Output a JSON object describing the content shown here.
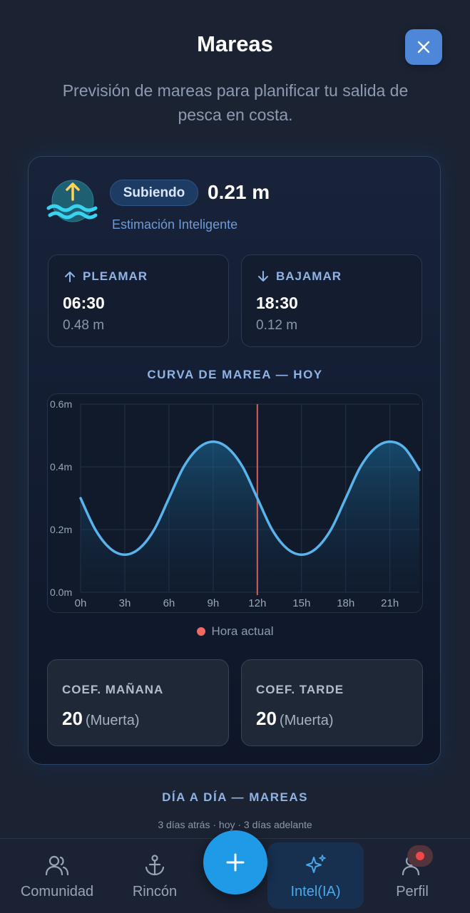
{
  "header": {
    "title": "Mareas",
    "subtitle": "Previsión de mareas para planificar tu salida de pesca en costa."
  },
  "status": {
    "trend_label": "Subiendo",
    "current_height": "0.21 m",
    "source_label": "Estimación Inteligente"
  },
  "high_tide": {
    "label": "PLEAMAR",
    "time": "06:30",
    "height": "0.48 m"
  },
  "low_tide": {
    "label": "BAJAMAR",
    "time": "18:30",
    "height": "0.12 m"
  },
  "curve": {
    "title": "CURVA DE MAREA — HOY",
    "legend_now": "Hora actual"
  },
  "chart_data": {
    "type": "area",
    "title": "CURVA DE MAREA — HOY",
    "x_ticks": [
      "0h",
      "3h",
      "6h",
      "9h",
      "12h",
      "15h",
      "18h",
      "21h"
    ],
    "y_ticks": [
      "0.0m",
      "0.2m",
      "0.4m",
      "0.6m"
    ],
    "xlim": [
      0,
      23
    ],
    "ylim": [
      0,
      0.6
    ],
    "current_hour": 12,
    "series": [
      {
        "x": [
          0,
          1,
          2,
          3,
          4,
          5,
          6,
          7,
          8,
          9,
          10,
          11,
          12,
          13,
          14,
          15,
          16,
          17,
          18,
          19,
          20,
          21,
          22,
          23
        ],
        "y": [
          0.3,
          0.2,
          0.14,
          0.12,
          0.14,
          0.2,
          0.3,
          0.4,
          0.46,
          0.48,
          0.46,
          0.4,
          0.3,
          0.2,
          0.14,
          0.12,
          0.14,
          0.2,
          0.3,
          0.4,
          0.46,
          0.48,
          0.46,
          0.39
        ]
      }
    ],
    "colors": {
      "line": "#5ab4ec",
      "now": "#f06a63",
      "grid": "#26324a"
    }
  },
  "coefficients": {
    "morning": {
      "label": "COEF. MAÑANA",
      "value": "20",
      "quality": "(Muerta)"
    },
    "afternoon": {
      "label": "COEF. TARDE",
      "value": "20",
      "quality": "(Muerta)"
    }
  },
  "daily": {
    "title": "DÍA A DÍA — MAREAS",
    "subtitle": "3 días atrás · hoy · 3 días adelante"
  },
  "nav": {
    "community": "Comunidad",
    "rincon": "Rincón",
    "intel": "Intel(IA)",
    "profile": "Perfil"
  }
}
